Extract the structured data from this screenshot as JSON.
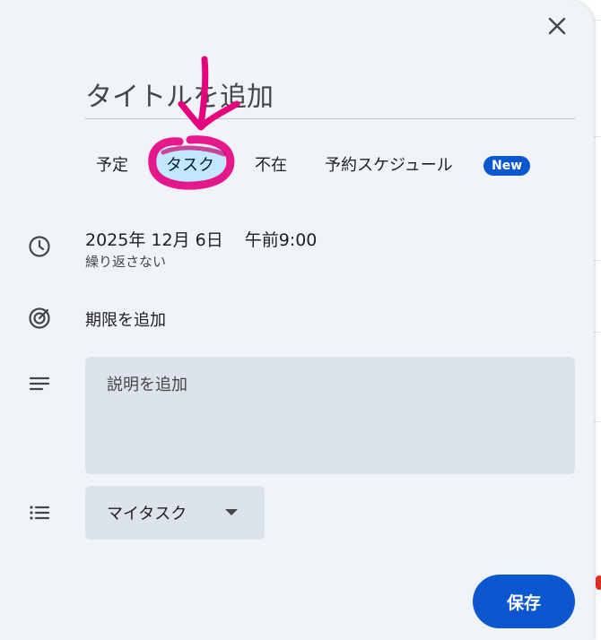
{
  "dialog": {
    "close_icon": "close-icon",
    "title_placeholder": "タイトルを追加",
    "tabs": [
      {
        "label": "予定",
        "selected": false
      },
      {
        "label": "タスク",
        "selected": true
      },
      {
        "label": "不在",
        "selected": false
      },
      {
        "label": "予約スケジュール",
        "selected": false
      }
    ],
    "new_badge": "New",
    "date": {
      "icon": "clock-icon",
      "date_text": "2025年 12月 6日",
      "time_text": "午前9:00",
      "repeat_text": "繰り返さない"
    },
    "deadline": {
      "icon": "target-icon",
      "label": "期限を追加"
    },
    "description": {
      "icon": "notes-icon",
      "placeholder": "説明を追加"
    },
    "task_list": {
      "icon": "list-icon",
      "selected_value": "マイタスク"
    },
    "save_label": "保存"
  },
  "colors": {
    "dialog_bg": "#f0f4f9",
    "accent": "#0b57d0",
    "selected_tab_bg": "#c2e7ff",
    "field_bg": "#dde3ea",
    "annotation_pink": "#e6007e"
  }
}
